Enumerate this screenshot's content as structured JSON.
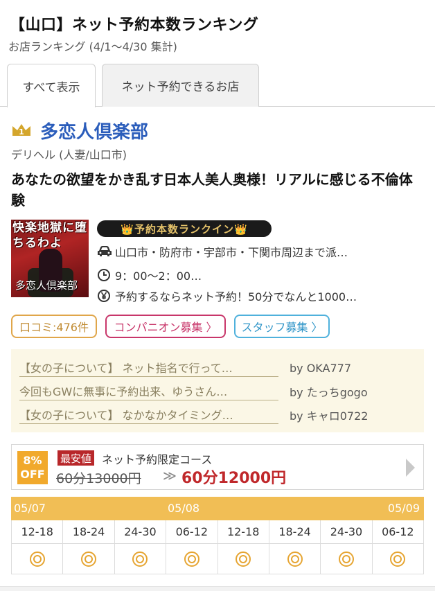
{
  "header": {
    "title": "【山口】ネット予約本数ランキング",
    "subtitle": "お店ランキング (4/1〜4/30 集計)"
  },
  "tabs": [
    {
      "label": "すべて表示",
      "active": true
    },
    {
      "label": "ネット予約できるお店",
      "active": false
    }
  ],
  "shop": {
    "rank": "1",
    "name": "多恋人倶楽部",
    "genre": "デリヘル (人妻/山口市)",
    "catch": "あなたの欲望をかき乱す日本人美人奥様！リアルに感じる不倫体験",
    "thumb_text": "快楽地獄に堕ちるわよ",
    "thumb_brand": "多恋人倶楽部",
    "rank_badge": "👑予約本数ランクイン👑",
    "area": "山口市・防府市・宇部市・下関市周辺まで派…",
    "hours": "9：00〜2：00…",
    "price_note": "予約するならネット予約！50分でなんと1000…"
  },
  "links": {
    "review": "口コミ:476件",
    "companion": "コンパニオン募集 〉",
    "staff": "スタッフ募集 〉"
  },
  "reviews": [
    {
      "text": "【女の子について】 ネット指名で行って…",
      "by": "by OKA777"
    },
    {
      "text": "今回もGWに無事に予約出来、ゆうさん…",
      "by": "by たっちgogo"
    },
    {
      "text": "【女の子について】 なかなかタイミング…",
      "by": "by キャロ0722"
    }
  ],
  "coupon": {
    "off_line1": "8%",
    "off_line2": "OFF",
    "badge": "最安値",
    "course": "ネット予約限定コース",
    "old_price": "60分13000円",
    "arrow": "≫",
    "new_price": "60分12000円"
  },
  "schedule": {
    "dates": [
      "05/07",
      "05/08",
      "05/09"
    ],
    "slots": [
      "12-18",
      "18-24",
      "24-30",
      "06-12",
      "12-18",
      "18-24",
      "24-30",
      "06-12"
    ],
    "availability": [
      "◎",
      "◎",
      "◎",
      "◎",
      "◎",
      "◎",
      "◎",
      "◎"
    ]
  },
  "colors": {
    "shop_name": "#2b5dbb",
    "schedule_header": "#f1be55",
    "price_red": "#c0282b",
    "review_pill": "#e0a64a",
    "companion_pill": "#c8366a",
    "staff_pill": "#4fb1dc"
  }
}
